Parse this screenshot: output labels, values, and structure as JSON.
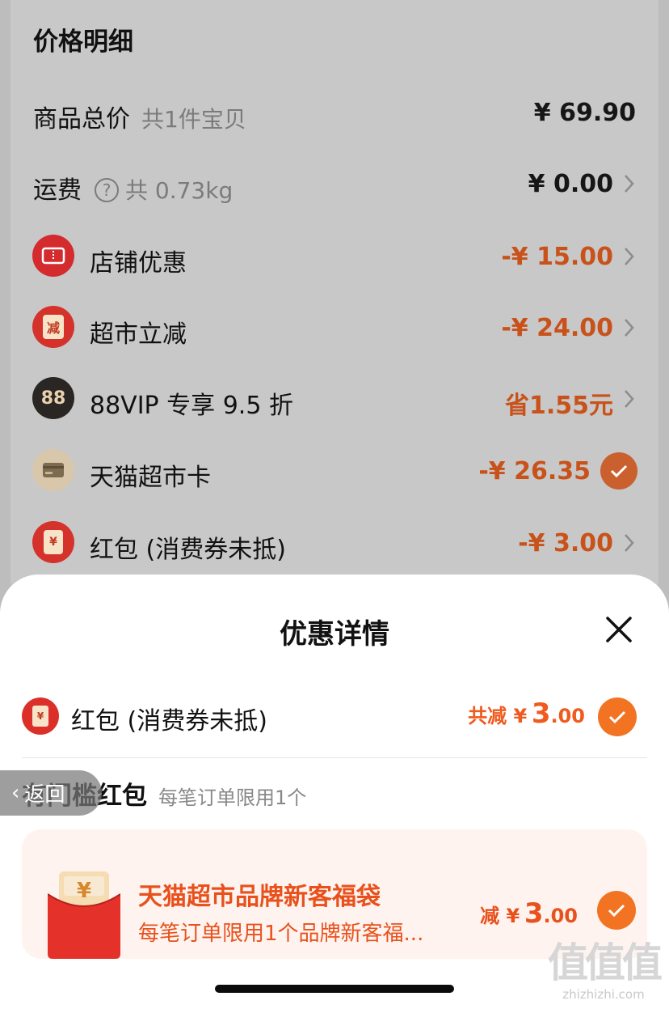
{
  "price_detail": {
    "title": "价格明细",
    "rows": [
      {
        "label": "商品总价",
        "sub": "共1件宝贝",
        "value": "¥ 69.90"
      },
      {
        "label": "运费",
        "sub": "共 0.73kg",
        "value": "¥ 0.00"
      },
      {
        "label": "店铺优惠",
        "value": "-¥ 15.00",
        "icon": "ticket-icon"
      },
      {
        "label": "超市立减",
        "value": "-¥ 24.00",
        "icon": "reduce-icon",
        "icon_text": "减"
      },
      {
        "label": "88VIP 专享 9.5 折",
        "value": "省1.55元",
        "icon": "vip88-icon",
        "icon_text": "88"
      },
      {
        "label": "天猫超市卡",
        "value": "-¥ 26.35",
        "icon": "card-icon",
        "checked": true
      },
      {
        "label": "红包 (消费券未抵)",
        "value": "-¥ 3.00",
        "icon": "red-packet-icon",
        "icon_text": "¥"
      }
    ]
  },
  "sheet": {
    "title": "优惠详情",
    "summary": {
      "label": "红包 (消费券未抵)",
      "prefix": "共减 ¥",
      "amount_int": "3",
      "amount_dec": ".00",
      "icon_text": "¥"
    },
    "section": {
      "title": "有门槛红包",
      "subtitle": "每笔订单限用1个"
    },
    "coupon": {
      "title": "天猫超市品牌新客福袋",
      "desc": "每笔订单限用1个品牌新客福...",
      "prefix": "减 ¥",
      "amount_int": "3",
      "amount_dec": ".00"
    }
  },
  "back_button": {
    "label": "返回"
  },
  "watermark": {
    "cn": "值值值",
    "en": "zhizhizhi.com"
  },
  "colors": {
    "accent_orange": "#f27321",
    "discount_red": "#c8521a",
    "coupon_bg": "#fff3ef"
  }
}
